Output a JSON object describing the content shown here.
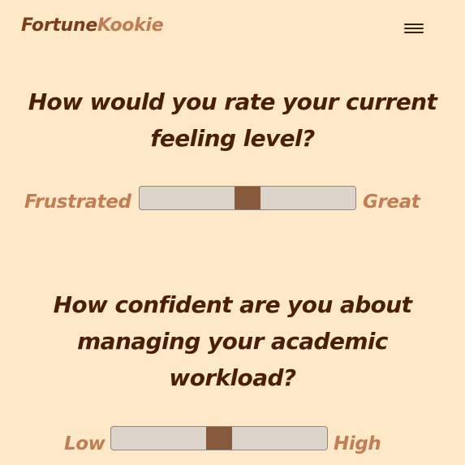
{
  "header": {
    "logo_part1": "Fortune",
    "logo_part2": "Kookie",
    "menu_icon": "hamburger-menu-icon"
  },
  "questions": [
    {
      "text": "How would you rate your current feeling level?",
      "min_label": "Frustrated",
      "max_label": "Great",
      "value_fraction": 0.5
    },
    {
      "text": "How confident are you about managing your academic workload?",
      "min_label": "Low",
      "max_label": "High",
      "value_fraction": 0.5
    }
  ],
  "colors": {
    "background": "#fde8c8",
    "logo_dark": "#7a3e1a",
    "logo_light": "#bf7c55",
    "question_text": "#4a1f0a",
    "slider_label": "#c17d55",
    "track": "#ddd5cc",
    "thumb": "#875a3c"
  }
}
